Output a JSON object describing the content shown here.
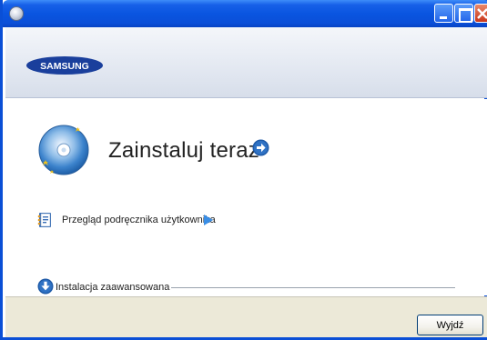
{
  "window": {
    "brand": "SAMSUNG"
  },
  "main": {
    "install_label": "Zainstaluj teraz",
    "manual_label": "Przegląd podręcznika użytkownika",
    "advanced_label": "Instalacja zaawansowana"
  },
  "footer": {
    "exit_label": "Wyjdź"
  },
  "icons": {
    "app": "app-icon",
    "minimize": "minimize-icon",
    "maximize": "maximize-icon",
    "close": "close-icon",
    "install": "cd-install-icon",
    "go": "arrow-right-circle-icon",
    "manual": "manual-book-icon",
    "manual_arrow": "triangle-right-icon",
    "advanced": "arrow-down-circle-icon"
  },
  "colors": {
    "titlebar": "#0a55e0",
    "brand_blue": "#1a3f9c",
    "link_arrow": "#3a8ee6",
    "close_button": "#c9361a"
  }
}
